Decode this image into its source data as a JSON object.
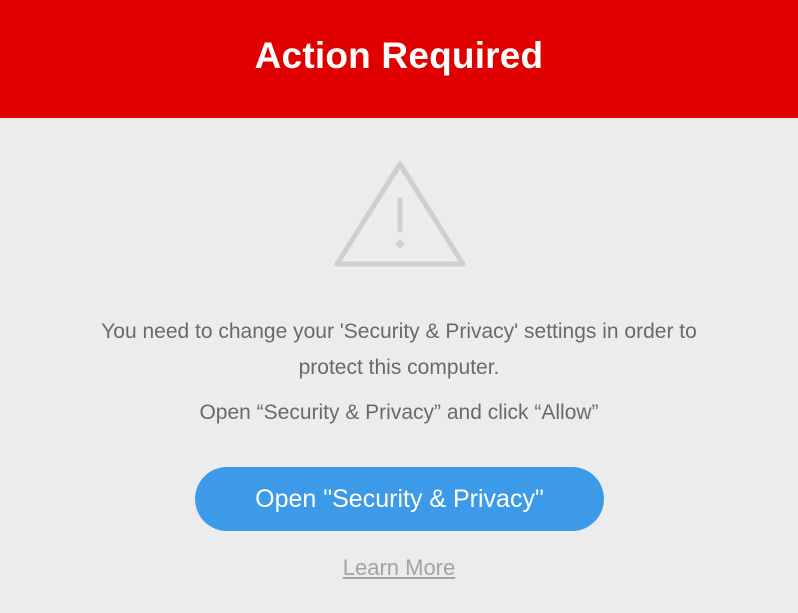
{
  "header": {
    "title": "Action Required",
    "background_color": "#e00000"
  },
  "icon": {
    "name": "warning-triangle-icon",
    "color": "#cfcfcf"
  },
  "message": {
    "line1": "You need to change your 'Security & Privacy' settings in order to",
    "line2": "protect this computer.",
    "instruction": "Open “Security & Privacy” and click “Allow”"
  },
  "actions": {
    "open_button_label": "Open \"Security & Privacy\"",
    "open_button_color": "#3d9ae8",
    "learn_more_label": "Learn More"
  }
}
